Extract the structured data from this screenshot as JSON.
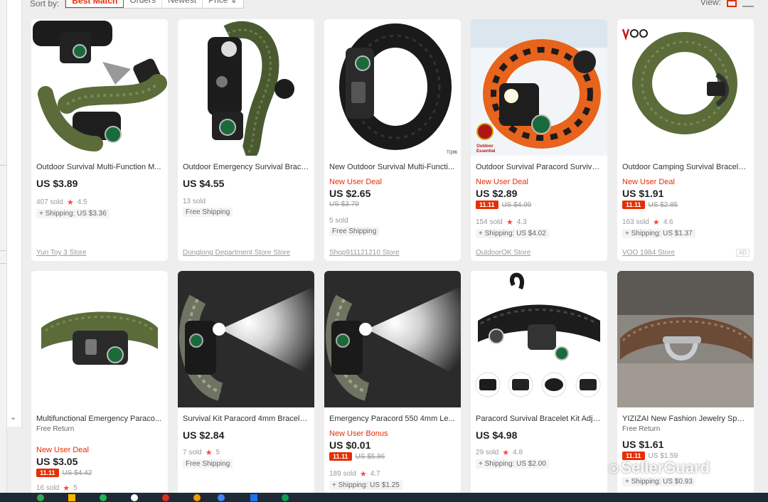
{
  "sort": {
    "label": "Sort by:",
    "options": [
      "Best Match",
      "Orders",
      "Newest",
      "Price ⇕"
    ]
  },
  "view": {
    "label": "View:"
  },
  "watermark": "SellerGuard",
  "products": [
    {
      "title": "Outdoor Survival Multi-Function M...",
      "deal": "",
      "price": "US $3.89",
      "orig": "",
      "sold": "407 sold",
      "rating": "4.5",
      "shipping": "+ Shipping: US $3.36",
      "store": "Yun Toy 3 Store"
    },
    {
      "title": "Outdoor Emergency Survival Brace...",
      "deal": "",
      "price": "US $4.55",
      "orig": "",
      "sold": "13 sold",
      "rating": "",
      "shipping": "Free Shipping",
      "store": "Donglong Department Store Store"
    },
    {
      "title": "New Outdoor Survival Multi-Functi...",
      "deal": "New User Deal",
      "price": "US $2.65",
      "orig": "US $3.79",
      "sold": "5 sold",
      "rating": "",
      "shipping": "Free Shipping",
      "store": "Shop911121210 Store"
    },
    {
      "title": "Outdoor Survival Paracord Survive...",
      "deal": "New User Deal",
      "price": "US $2.89",
      "orig": "US $4.99",
      "tag": "11.11",
      "sold": "154 sold",
      "rating": "4.3",
      "shipping": "+ Shipping: US $4.02",
      "store": "OutdoorOK Store"
    },
    {
      "title": "Outdoor Camping Survival Bracele...",
      "deal": "New User Deal",
      "price": "US $1.91",
      "orig": "US $2.85",
      "tag": "11.11",
      "sold": "163 sold",
      "rating": "4.6",
      "shipping": "+ Shipping: US $1.37",
      "store": "VOO 1984 Store",
      "badge": "AD"
    },
    {
      "title": "Multifunctional Emergency Paraco...",
      "free_return": "Free Return",
      "deal": "New User Deal",
      "price": "US $3.05",
      "orig": "US $4.42",
      "tag": "11.11",
      "sold": "16 sold",
      "rating": "5"
    },
    {
      "title": "Survival Kit Paracord 4mm Bracele...",
      "price": "US $2.84",
      "sold": "7 sold",
      "rating": "5",
      "shipping": "Free Shipping"
    },
    {
      "title": "Emergency Paracord 550 4mm Le...",
      "deal": "New User Bonus",
      "price": "US $0.01",
      "orig": "US $5.86",
      "tag": "11.11",
      "sold": "189 sold",
      "rating": "4.7",
      "shipping": "+ Shipping: US $1.25"
    },
    {
      "title": "Paracord Survival Bracelet Kit Adju...",
      "price": "US $4.98",
      "sold": "29 sold",
      "rating": "4.8",
      "shipping": "+ Shipping: US $2.00"
    },
    {
      "title": "YIZIZAI New Fashion Jewelry Sport ...",
      "free_return": "Free Return",
      "price": "US $1.61",
      "orig": "US $1.59",
      "tag": "11.11",
      "shipping": "+ Shipping: US $0.93"
    }
  ],
  "colors": {
    "accent": "#e62e04",
    "cord_green": "#5b6b3a",
    "cord_black": "#1c1c1c",
    "cord_orange": "#e8631c",
    "cord_brown": "#6b4a36"
  }
}
